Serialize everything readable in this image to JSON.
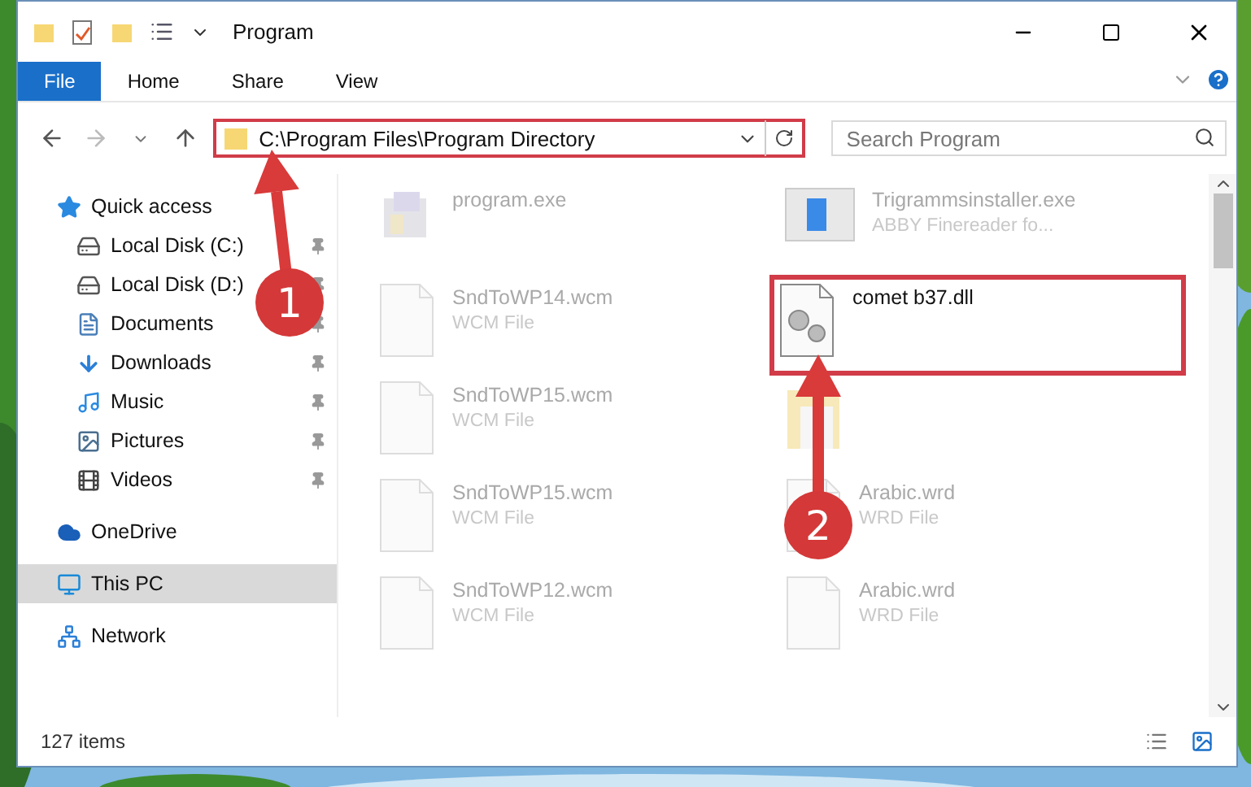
{
  "window": {
    "title": "Program"
  },
  "ribbon_tabs": [
    {
      "label": "File",
      "selected": true
    },
    {
      "label": "Home",
      "selected": false
    },
    {
      "label": "Share",
      "selected": false
    },
    {
      "label": "View",
      "selected": false
    }
  ],
  "address_bar": {
    "path": "C:\\Program Files\\Program Directory",
    "highlighted": true
  },
  "search": {
    "placeholder": "Search Program"
  },
  "sidebar": {
    "items": [
      {
        "label": "Quick access",
        "kind": "star",
        "selected": false,
        "children": [
          {
            "label": "Local Disk (C:)",
            "kind": "disk-c",
            "pinned": true,
            "selected": false
          },
          {
            "label": "Local Disk (D:)",
            "kind": "disk",
            "pinned": true,
            "selected": false
          },
          {
            "label": "Documents",
            "kind": "documents",
            "pinned": true,
            "selected": false
          },
          {
            "label": "Downloads",
            "kind": "downloads",
            "pinned": true,
            "selected": false
          },
          {
            "label": "Music",
            "kind": "music",
            "pinned": true,
            "selected": false
          },
          {
            "label": "Pictures",
            "kind": "pictures",
            "pinned": true,
            "selected": false
          },
          {
            "label": "Videos",
            "kind": "videos",
            "pinned": true,
            "selected": false
          }
        ]
      },
      {
        "label": "OneDrive",
        "kind": "cloud",
        "selected": false
      },
      {
        "label": "This PC",
        "kind": "pc",
        "selected": true
      },
      {
        "label": "Network",
        "kind": "network",
        "selected": false
      }
    ]
  },
  "files": [
    {
      "name": "program.exe",
      "kind": "exe",
      "highlighted": false
    },
    {
      "name": "Trigrammsinstaller.exe",
      "type": "ABBY Finereader fo...",
      "kind": "app",
      "highlighted": false
    },
    {
      "name": "SndToWP14.wcm",
      "type": "WCM File",
      "kind": "file",
      "highlighted": false
    },
    {
      "name": "comet b37.dll",
      "kind": "dll",
      "highlighted": true
    },
    {
      "name": "SndToWP15.wcm",
      "type": "WCM File",
      "kind": "file",
      "highlighted": false
    },
    {
      "kind": "folder",
      "highlighted": false
    },
    {
      "name": "SndToWP15.wcm",
      "type": "WCM File",
      "kind": "file",
      "highlighted": false
    },
    {
      "name": "Arabic.wrd",
      "type": "WRD File",
      "kind": "file",
      "highlighted": false
    },
    {
      "name": "SndToWP12.wcm",
      "type": "WCM File",
      "kind": "file",
      "highlighted": false
    },
    {
      "name": "Arabic.wrd",
      "type": "WRD File",
      "kind": "file",
      "highlighted": false
    }
  ],
  "status_bar": {
    "count": "127 items"
  },
  "annotations": [
    {
      "number": "1"
    },
    {
      "number": "2"
    }
  ]
}
